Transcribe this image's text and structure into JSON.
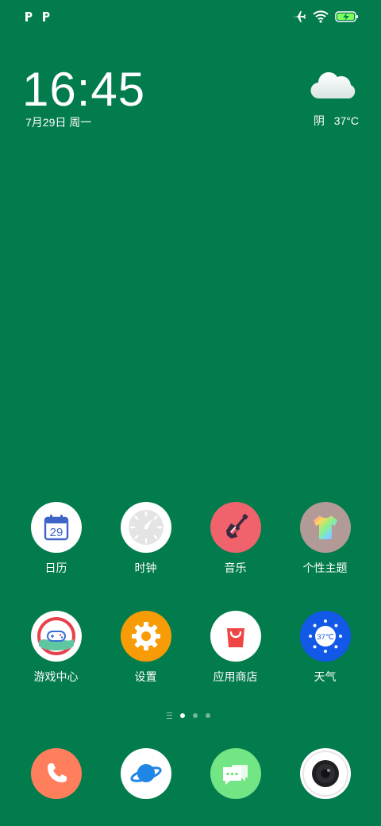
{
  "status_bar": {
    "left_icons": [
      "p-notification-icon",
      "p-notification-icon"
    ],
    "right_icons": [
      "airplane-icon",
      "wifi-icon",
      "battery-charging-icon"
    ]
  },
  "lockclock": {
    "time": "16:45",
    "date": "7月29日 周一"
  },
  "weather_widget": {
    "condition": "阴",
    "temperature": "37°C",
    "icon": "cloud-icon"
  },
  "home_rows": [
    [
      {
        "label": "日历",
        "icon": "calendar-icon",
        "day": "29",
        "color": "#ffffff"
      },
      {
        "label": "时钟",
        "icon": "clock-icon",
        "color": "#ffffff"
      },
      {
        "label": "音乐",
        "icon": "guitar-icon",
        "color": "#f0636c"
      },
      {
        "label": "个性主题",
        "icon": "tshirt-icon",
        "color": "#b29a96"
      }
    ],
    [
      {
        "label": "游戏中心",
        "icon": "game-center-icon",
        "color": "#ffffff"
      },
      {
        "label": "设置",
        "icon": "gear-icon",
        "color": "#f79b06"
      },
      {
        "label": "应用商店",
        "icon": "shopping-bag-icon",
        "color": "#ffffff"
      },
      {
        "label": "天气",
        "icon": "weather-sun-icon",
        "temp": "37℃",
        "color": "#1259e8"
      }
    ]
  ],
  "page_indicator": {
    "pages": 3,
    "active": 0
  },
  "dock": [
    {
      "name": "phone",
      "icon": "phone-icon",
      "color": "#ff7e5b"
    },
    {
      "name": "browser",
      "icon": "planet-icon",
      "color": "#ffffff"
    },
    {
      "name": "messages",
      "icon": "chat-icon",
      "color": "#72e584"
    },
    {
      "name": "camera",
      "icon": "camera-icon",
      "color": "#ffffff"
    }
  ]
}
